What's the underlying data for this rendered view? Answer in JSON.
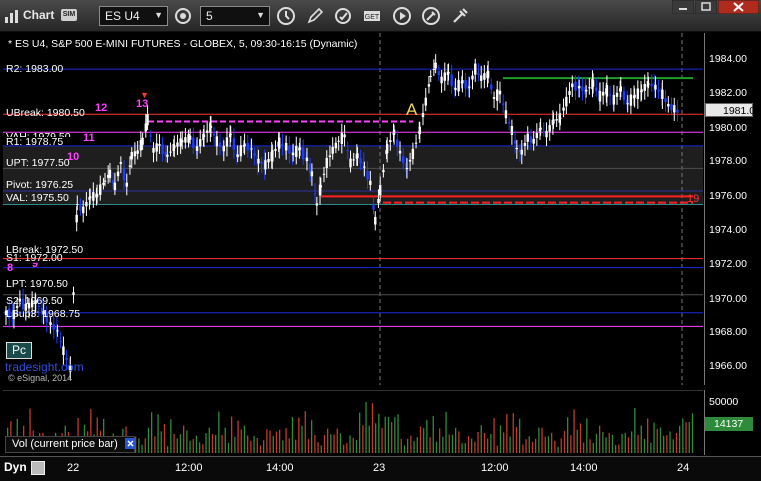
{
  "window": {
    "title": "Chart",
    "badge": "SIM",
    "symbol": "ES U4",
    "interval": "5",
    "toolbar_icons": [
      "link-icon",
      "refresh-cycle-icon",
      "clock-icon",
      "pencil-icon",
      "refresh-icon",
      "fx-icon",
      "play-icon",
      "spanner-icon",
      "dropper-icon"
    ],
    "window_buttons": [
      "minimize-icon",
      "maximize-icon",
      "close-icon"
    ]
  },
  "chart": {
    "info": "* ES U4, S&P 500 E-MINI FUTURES - GLOBEX, 5, 09:30-16:15 (Dynamic)",
    "levels": [
      {
        "label": "R2: 1983.00",
        "price": 1983.0,
        "color": "#1b2ad6"
      },
      {
        "label": "UBreak: 1980.50",
        "price": 1980.5,
        "color": "#ff3232"
      },
      {
        "label": "VAH: 1979.50",
        "price": 1979.5,
        "color": "#ff40ff"
      },
      {
        "label": "R1: 1978.75",
        "price": 1978.75,
        "color": "#1b2ad6"
      },
      {
        "label": "UPT: 1977.50",
        "price": 1977.5,
        "color": "#4f4f4f"
      },
      {
        "label": "Pivot: 1976.25",
        "price": 1976.25,
        "color": "#3030a0"
      },
      {
        "label": "VAL: 1975.50",
        "price": 1975.5,
        "color": "#2e8b8b"
      },
      {
        "label": "LBreak: 1972.50",
        "price": 1972.5,
        "color": "#ff3232"
      },
      {
        "label": "S1: 1972.00",
        "price": 1972.0,
        "color": "#1b2ad6"
      },
      {
        "label": "LPT: 1970.50",
        "price": 1970.5,
        "color": "#4f4f4f"
      },
      {
        "label": "S2: 1969.50",
        "price": 1969.5,
        "color": "#1b2ad6"
      },
      {
        "label": "LSup3: 1968.75",
        "price": 1968.75,
        "color": "#ff40ff"
      }
    ],
    "price_ticks": [
      "1984.00",
      "1982.00",
      "1980.00",
      "1978.00",
      "1976.00",
      "1974.00",
      "1972.00",
      "1970.00",
      "1968.00",
      "1966.00"
    ],
    "last_price": "1981.00",
    "markers": [
      {
        "text": "12",
        "color": "#ff40ff"
      },
      {
        "text": "13",
        "color": "#ff40ff"
      },
      {
        "text": "11",
        "color": "#ff40ff"
      },
      {
        "text": "10",
        "color": "#ff40ff"
      },
      {
        "text": "8",
        "color": "#ff40ff"
      },
      {
        "text": "9",
        "color": "#ff40ff"
      },
      {
        "text": "A",
        "color": "#e8d65c"
      },
      {
        "text": "19",
        "color": "#ff3232"
      }
    ],
    "pc_button": "Pc",
    "watermark": "tradesight.com",
    "copyright": "© eSignal, 2014"
  },
  "volume": {
    "label": "Vol (current price bar)",
    "ticks": [
      "50000"
    ],
    "last": "14137"
  },
  "time_axis": {
    "dyn_label": "Dyn",
    "ticks": [
      "22",
      "12:00",
      "14:00",
      "23",
      "12:00",
      "14:00",
      "24"
    ]
  },
  "chart_data": {
    "type": "candlestick",
    "ylim": [
      1965.5,
      1985.0
    ],
    "session_dividers": [
      "23",
      "24"
    ],
    "close_path": [
      [
        0,
        1969.5
      ],
      [
        8,
        1969.4
      ],
      [
        14,
        1970.2
      ],
      [
        20,
        1969.8
      ],
      [
        30,
        1970.1
      ],
      [
        38,
        1969.5
      ],
      [
        45,
        1968.9
      ],
      [
        52,
        1968.5
      ],
      [
        58,
        1967.4
      ],
      [
        65,
        1966.4
      ],
      [
        72,
        1975.5
      ],
      [
        78,
        1975.2
      ],
      [
        85,
        1975.9
      ],
      [
        92,
        1976.0
      ],
      [
        100,
        1976.8
      ],
      [
        105,
        1977.2
      ],
      [
        110,
        1976.5
      ],
      [
        116,
        1977.8
      ],
      [
        122,
        1976.6
      ],
      [
        127,
        1978.2
      ],
      [
        133,
        1978.4
      ],
      [
        138,
        1979.0
      ],
      [
        143,
        1980.2
      ],
      [
        149,
        1978.5
      ],
      [
        155,
        1978.8
      ],
      [
        163,
        1978.2
      ],
      [
        170,
        1978.7
      ],
      [
        178,
        1979.0
      ],
      [
        186,
        1979.2
      ],
      [
        193,
        1978.6
      ],
      [
        200,
        1979.3
      ],
      [
        207,
        1979.8
      ],
      [
        213,
        1979.0
      ],
      [
        220,
        1978.6
      ],
      [
        227,
        1979.4
      ],
      [
        234,
        1978.2
      ],
      [
        241,
        1978.8
      ],
      [
        248,
        1978.6
      ],
      [
        255,
        1977.9
      ],
      [
        262,
        1977.7
      ],
      [
        269,
        1978.2
      ],
      [
        276,
        1978.9
      ],
      [
        283,
        1978.7
      ],
      [
        290,
        1978.3
      ],
      [
        297,
        1978.6
      ],
      [
        304,
        1978.0
      ],
      [
        309,
        1977.2
      ],
      [
        314,
        1975.5
      ],
      [
        318,
        1976.5
      ],
      [
        324,
        1977.8
      ],
      [
        330,
        1978.5
      ],
      [
        336,
        1979.0
      ],
      [
        342,
        1979.3
      ],
      [
        348,
        1977.8
      ],
      [
        355,
        1978.2
      ],
      [
        362,
        1977.6
      ],
      [
        368,
        1976.7
      ],
      [
        373,
        1974.6
      ],
      [
        378,
        1976.3
      ],
      [
        385,
        1978.6
      ],
      [
        392,
        1979.5
      ],
      [
        398,
        1978.4
      ],
      [
        405,
        1977.5
      ],
      [
        411,
        1978.3
      ],
      [
        418,
        1979.6
      ],
      [
        424,
        1981.2
      ],
      [
        429,
        1982.6
      ],
      [
        434,
        1983.2
      ],
      [
        440,
        1982.4
      ],
      [
        447,
        1982.8
      ],
      [
        454,
        1981.9
      ],
      [
        461,
        1982.3
      ],
      [
        468,
        1982.0
      ],
      [
        474,
        1983.0
      ],
      [
        480,
        1982.5
      ],
      [
        487,
        1982.7
      ],
      [
        493,
        1981.4
      ],
      [
        499,
        1981.7
      ],
      [
        505,
        1980.5
      ],
      [
        511,
        1979.6
      ],
      [
        516,
        1978.6
      ],
      [
        521,
        1978.4
      ],
      [
        527,
        1979.2
      ],
      [
        533,
        1979.0
      ],
      [
        540,
        1979.7
      ],
      [
        546,
        1979.4
      ],
      [
        553,
        1980.1
      ],
      [
        560,
        1980.3
      ],
      [
        566,
        1981.2
      ],
      [
        572,
        1982.1
      ],
      [
        579,
        1982.0
      ],
      [
        586,
        1981.8
      ],
      [
        593,
        1982.2
      ],
      [
        600,
        1981.5
      ],
      [
        607,
        1981.8
      ],
      [
        614,
        1981.3
      ],
      [
        621,
        1981.9
      ],
      [
        628,
        1981.1
      ],
      [
        635,
        1981.5
      ],
      [
        642,
        1981.8
      ],
      [
        649,
        1982.2
      ],
      [
        656,
        1982.0
      ],
      [
        663,
        1981.6
      ],
      [
        669,
        1981.0
      ],
      [
        675,
        1980.8
      ],
      [
        680,
        1980.6
      ]
    ]
  }
}
